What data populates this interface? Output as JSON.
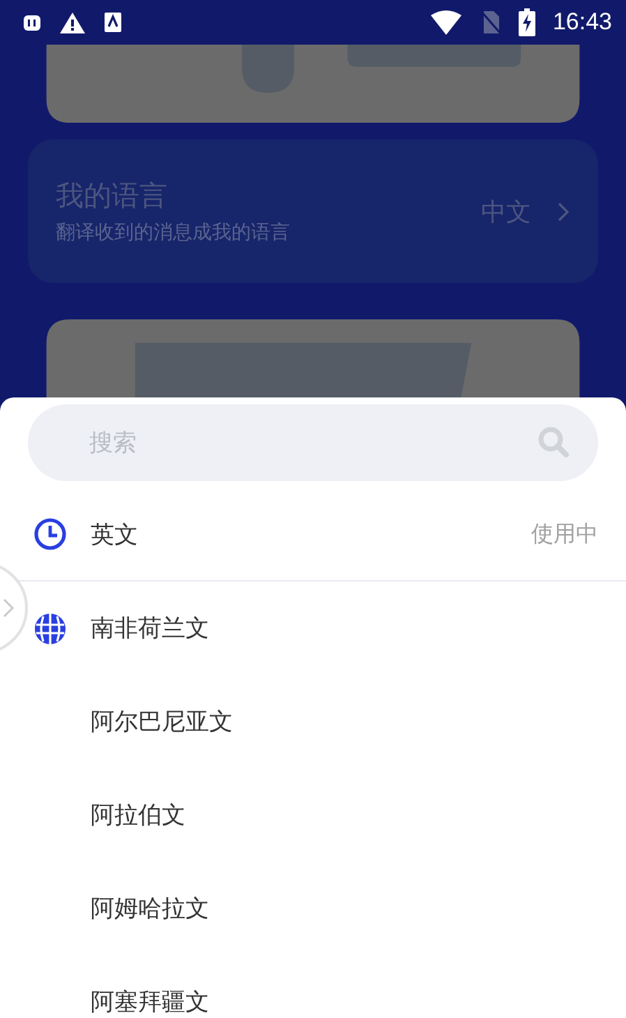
{
  "status_bar": {
    "time": "16:43"
  },
  "language_card": {
    "title": "我的语言",
    "subtitle": "翻译收到的消息成我的语言",
    "value": "中文"
  },
  "search": {
    "placeholder": "搜索"
  },
  "languages": [
    {
      "name": "英文",
      "kind": "recent",
      "status": "使用中",
      "divider": true
    },
    {
      "name": "南非荷兰文",
      "kind": "group",
      "divider": false
    },
    {
      "name": "阿尔巴尼亚文",
      "kind": "plain",
      "divider": false
    },
    {
      "name": "阿拉伯文",
      "kind": "plain",
      "divider": false
    },
    {
      "name": "阿姆哈拉文",
      "kind": "plain",
      "divider": false
    },
    {
      "name": "阿塞拜疆文",
      "kind": "plain"
    }
  ]
}
